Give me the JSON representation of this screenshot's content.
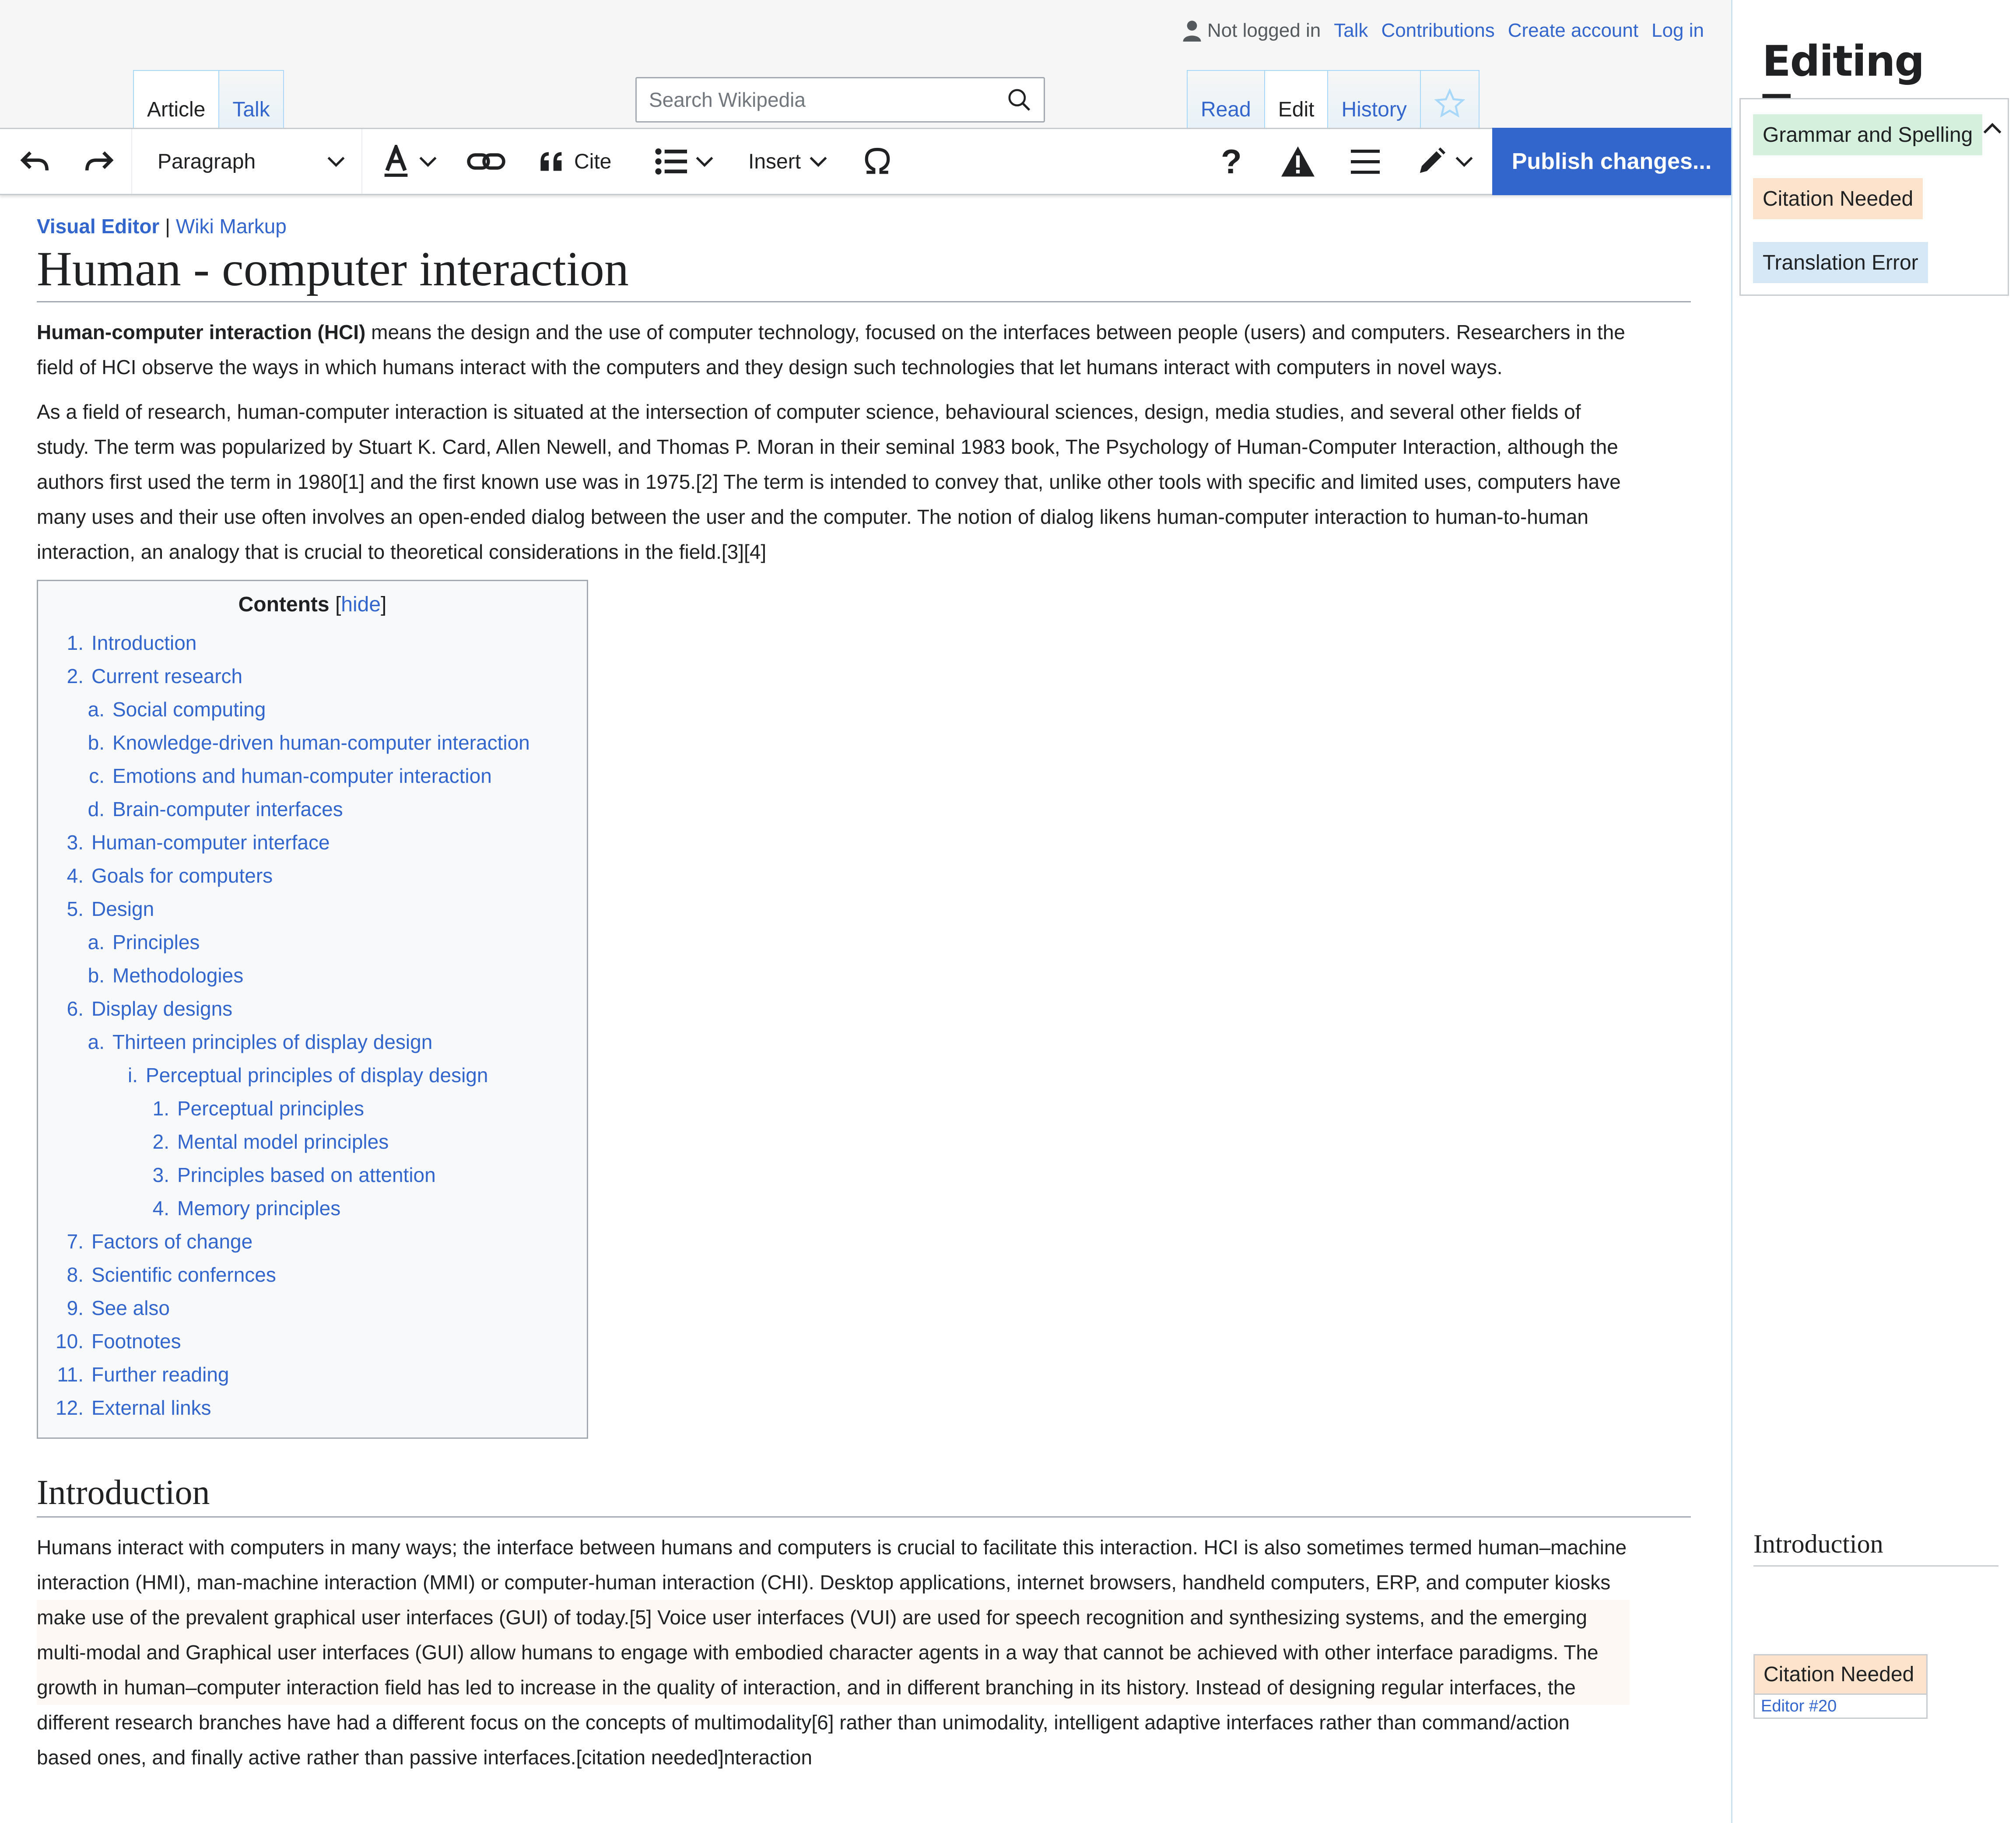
{
  "header": {
    "personal": {
      "status": "Not logged in",
      "links": [
        "Talk",
        "Contributions",
        "Create account",
        "Log in"
      ]
    },
    "left_tabs": [
      "Article",
      "Talk"
    ],
    "right_tabs": [
      "Read",
      "Edit",
      "History"
    ],
    "search_placeholder": "Search Wikipedia"
  },
  "toolbar": {
    "paragraph": "Paragraph",
    "cite": "Cite",
    "insert": "Insert",
    "help": "?",
    "publish": "Publish changes..."
  },
  "article": {
    "mode_active": "Visual Editor",
    "mode_sep": "|",
    "mode_link": "Wiki Markup",
    "title": "Human - computer interaction",
    "p1_bold": "Human-computer interaction (HCI)",
    "p1_rest": " means the design and the use of computer technology, focused on the interfaces between people (users) and computers. Researchers in the field of HCI observe the ways in which humans interact with the computers and they design such technologies that let humans interact with computers in novel ways.",
    "p2": "As a field of research, human-computer interaction is situated at the intersection of computer science, behavioural sciences, design, media studies, and several other fields of study. The term was popularized by Stuart K. Card, Allen Newell, and Thomas P. Moran in their seminal 1983 book, The Psychology of Human-Computer Interaction, although the authors first used the term in 1980[1] and the first known use was in 1975.[2] The term is intended to convey that, unlike other tools with specific and limited uses, computers have many uses and their use often involves an open-ended dialog between the user and the computer. The notion of dialog likens human-computer interaction to human-to-human interaction, an analogy that is crucial to theoretical considerations in the field.[3][4]",
    "toc": {
      "title": "Contents",
      "hide": "hide",
      "items": [
        {
          "num": "1.",
          "label": "Introduction",
          "level": 0
        },
        {
          "num": "2.",
          "label": "Current research",
          "level": 0
        },
        {
          "num": "a.",
          "label": "Social computing",
          "level": 1
        },
        {
          "num": "b.",
          "label": "Knowledge-driven human-computer interaction",
          "level": 1
        },
        {
          "num": "c.",
          "label": "Emotions and human-computer interaction",
          "level": 1
        },
        {
          "num": "d.",
          "label": "Brain-computer interfaces",
          "level": 1
        },
        {
          "num": "3.",
          "label": "Human-computer interface",
          "level": 0
        },
        {
          "num": "4.",
          "label": "Goals for computers",
          "level": 0
        },
        {
          "num": "5.",
          "label": "Design",
          "level": 0
        },
        {
          "num": "a.",
          "label": "Principles",
          "level": 1
        },
        {
          "num": "b.",
          "label": "Methodologies",
          "level": 1
        },
        {
          "num": "6.",
          "label": "Display designs",
          "level": 0
        },
        {
          "num": "a.",
          "label": "Thirteen principles of display design",
          "level": 1
        },
        {
          "num": "i.",
          "label": "Perceptual principles of display design",
          "level": 2
        },
        {
          "num": "1.",
          "label": "Perceptual principles",
          "level": 3
        },
        {
          "num": "2.",
          "label": "Mental model principles",
          "level": 3
        },
        {
          "num": "3.",
          "label": "Principles based on attention",
          "level": 3
        },
        {
          "num": "4.",
          "label": "Memory principles",
          "level": 3
        },
        {
          "num": "7.",
          "label": "Factors of change",
          "level": 0
        },
        {
          "num": "8.",
          "label": "Scientific confernces",
          "level": 0
        },
        {
          "num": "9.",
          "label": "See also",
          "level": 0
        },
        {
          "num": "10.",
          "label": "Footnotes",
          "level": 0
        },
        {
          "num": "11.",
          "label": "Further reading",
          "level": 0
        },
        {
          "num": "12.",
          "label": "External links",
          "level": 0
        }
      ]
    },
    "intro_heading": "Introduction",
    "intro_text": "Humans interact with computers in many ways; the interface between humans and computers is crucial to facilitate this interaction. HCI is also sometimes termed human–machine interaction (HMI), man-machine interaction (MMI) or computer-human interaction (CHI). Desktop applications, internet browsers, handheld computers, ERP, and computer kiosks make use of the prevalent graphical user interfaces (GUI) of today.[5] Voice user interfaces (VUI) are used for speech recognition and synthesizing systems, and the emerging multi-modal and Graphical user interfaces (GUI) allow humans to engage with embodied character agents in a way that cannot be achieved with other interface paradigms. The growth in human–computer interaction field has led to increase in the quality of interaction, and in different branching in its history. Instead of designing regular interfaces, the different research branches have had a different focus on the concepts of multimodality[6] rather than unimodality, intelligent adaptive interfaces rather than command/action based ones, and finally active rather than passive interfaces.[citation needed]nteraction"
  },
  "sidebar": {
    "title": "Editing Tags",
    "tags": [
      "Grammar and Spelling",
      "Citation Needed",
      "Translation Error"
    ],
    "tag_colors": {
      "grammar": "#d5f0dd",
      "citation": "#fde3cc",
      "translation": "#d6e8f5"
    },
    "section": "Introduction",
    "card_tag": "Citation Needed",
    "card_editor": "Editor #20"
  },
  "colors": {
    "link": "#3366cc",
    "publish": "#3366cc",
    "text": "#202122"
  }
}
